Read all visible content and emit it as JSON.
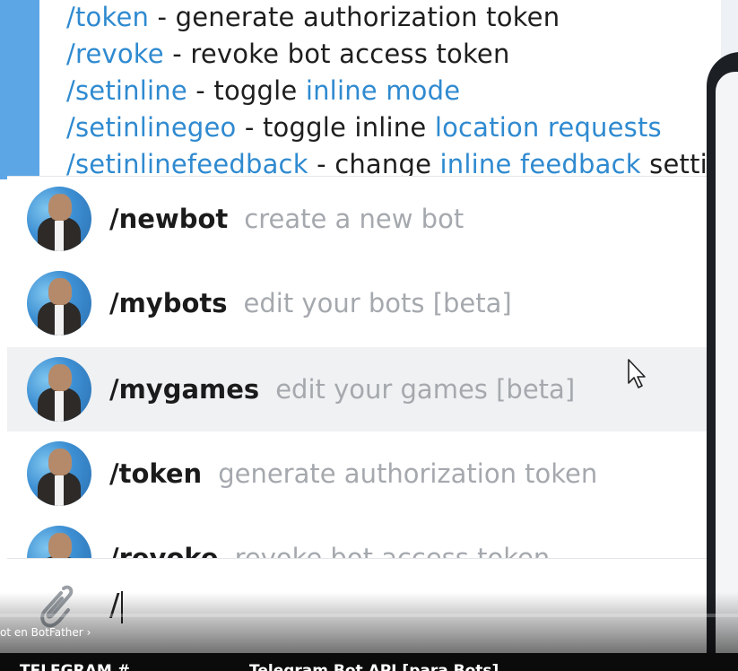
{
  "message": {
    "lines": [
      {
        "cmd": "/token",
        "sep": " - ",
        "text": "generate authorization token",
        "link": ""
      },
      {
        "cmd": "/revoke",
        "sep": " - ",
        "text": "revoke bot access token",
        "link": ""
      },
      {
        "cmd": "/setinline",
        "sep": " - ",
        "text": "toggle ",
        "link": "inline mode"
      },
      {
        "cmd": "/setinlinegeo",
        "sep": " - ",
        "text": "toggle inline ",
        "link": "location requests"
      },
      {
        "cmd": "/setinlinefeedback",
        "sep": " - ",
        "text": "change ",
        "link": "inline feedback",
        "tail": " setting"
      }
    ]
  },
  "commands": [
    {
      "cmd": "/newbot",
      "desc": "create a new bot"
    },
    {
      "cmd": "/mybots",
      "desc": "edit your bots [beta]"
    },
    {
      "cmd": "/mygames",
      "desc": "edit your games [beta]"
    },
    {
      "cmd": "/token",
      "desc": "generate authorization token"
    },
    {
      "cmd": "/revoke",
      "desc": "revoke bot access token"
    }
  ],
  "input": {
    "value": "/"
  },
  "player": {
    "channel_link": "ot en BotFather",
    "bottom_left": "TELEGRAM #",
    "bottom_right": "Telegram Bot API [para Bots]"
  },
  "colors": {
    "link": "#2f8ad0",
    "accent_bar": "#5da6e6",
    "hover_row": "#f0f1f3"
  }
}
